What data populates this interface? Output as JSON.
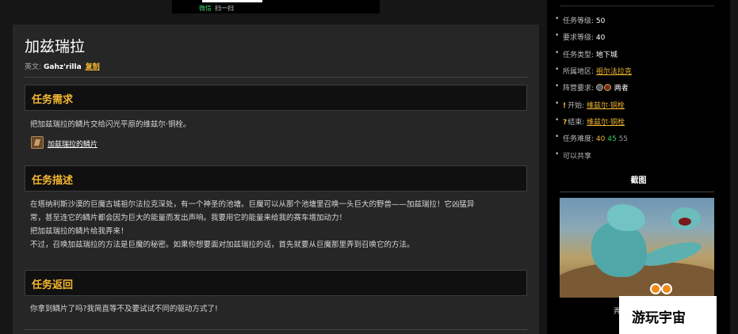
{
  "promo": {
    "wechat": "微信",
    "scan": "扫一扫"
  },
  "quest": {
    "title": "加兹瑞拉",
    "en_label": "英文:",
    "en_name": "Gahz'rilla",
    "copy_label": "复制"
  },
  "requirements": {
    "heading": "任务需求",
    "text": "把加兹瑞拉的鳞片交给闪光平原的维兹尔·铜栓。",
    "item": {
      "name": "加兹瑞拉的鳞片",
      "icon": "scale-item-icon"
    }
  },
  "description": {
    "heading": "任务描述",
    "lines": [
      "在塔纳利斯沙漠的巨魔古城祖尔法拉克深处，有一个神圣的池塘。巨魔可以从那个池塘里召唤一头巨大的野兽——加兹瑞拉！它凶猛异",
      "常，甚至连它的鳞片都会因为巨大的能量而发出声响。我要用它的能量来给我的赛车增加动力！",
      "把加兹瑞拉的鳞片给我弄来！",
      "不过，召唤加兹瑞拉的方法是巨魔的秘密。如果你想要面对加兹瑞拉的话，首先就要从巨魔那里弄到召唤它的方法。"
    ]
  },
  "return": {
    "heading": "任务返回",
    "text": "你拿到鳞片了吗?我简直等不及要试试不同的驱动方式了!"
  },
  "sidebar": {
    "level": {
      "label": "任务等级:",
      "value": "50"
    },
    "req_level": {
      "label": "要求等级:",
      "value": "40"
    },
    "type": {
      "label": "任务类型:",
      "value": "地下城"
    },
    "zone": {
      "label": "所属地区:",
      "value": "祖尔法拉克"
    },
    "faction": {
      "label": "阵营要求:",
      "value": "两者"
    },
    "start": {
      "label": "开始:",
      "value": "维兹尔·铜栓"
    },
    "end": {
      "label": "结束:",
      "value": "维兹尔·铜栓"
    },
    "difficulty": {
      "label": "任务难度:",
      "values": [
        "40",
        "45",
        "55"
      ]
    },
    "shareable": "可以共享",
    "screenshot_title": "截图",
    "below_text": "弄"
  },
  "watermark": "游玩宇宙",
  "colors": {
    "accent": "#f5b731",
    "green": "#3cd16b",
    "panel": "#262626"
  }
}
